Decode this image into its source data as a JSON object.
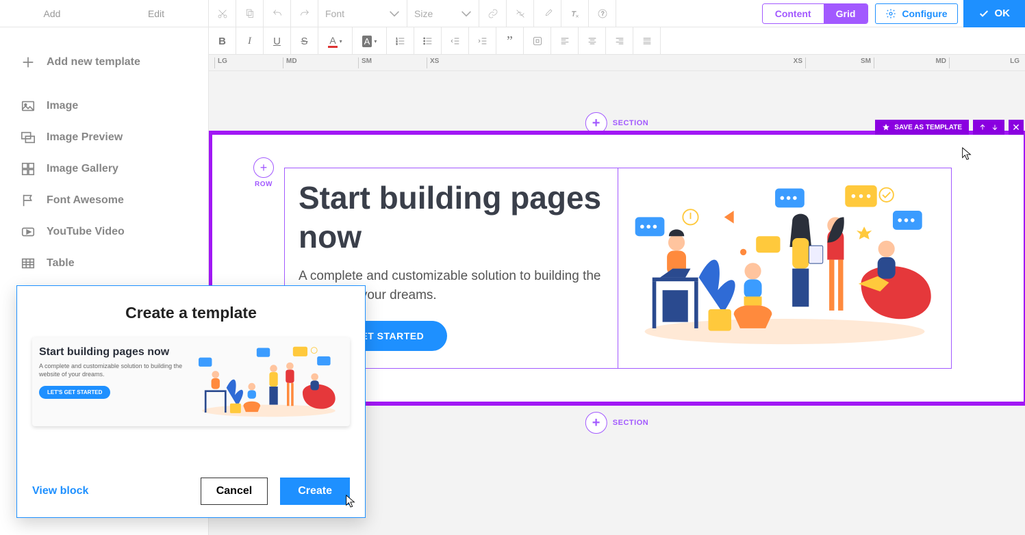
{
  "leftTabs": {
    "add": "Add",
    "edit": "Edit"
  },
  "sidebar": {
    "addNew": "Add new template",
    "items": [
      {
        "label": "Image"
      },
      {
        "label": "Image Preview"
      },
      {
        "label": "Image Gallery"
      },
      {
        "label": "Font Awesome"
      },
      {
        "label": "YouTube Video"
      },
      {
        "label": "Table"
      }
    ]
  },
  "toolbar": {
    "fontLabel": "Font",
    "sizeLabel": "Size",
    "content": "Content",
    "grid": "Grid",
    "configure": "Configure",
    "ok": "OK"
  },
  "breakpoints": {
    "lg": "LG",
    "md": "MD",
    "sm": "SM",
    "xs": "XS"
  },
  "sectionLabel": "SECTION",
  "rowLabel": "ROW",
  "saveAsTemplate": "SAVE AS TEMPLATE",
  "hero": {
    "title": "Start building pages now",
    "subtitle": "A complete and customizable solution to building the website of your dreams.",
    "cta": "LET'S GET STARTED"
  },
  "modal": {
    "title": "Create a template",
    "previewTitle": "Start building pages now",
    "previewSub": "A complete and customizable solution to building the website of your dreams.",
    "previewCta": "LET'S GET STARTED",
    "viewBlock": "View block",
    "cancel": "Cancel",
    "create": "Create"
  }
}
